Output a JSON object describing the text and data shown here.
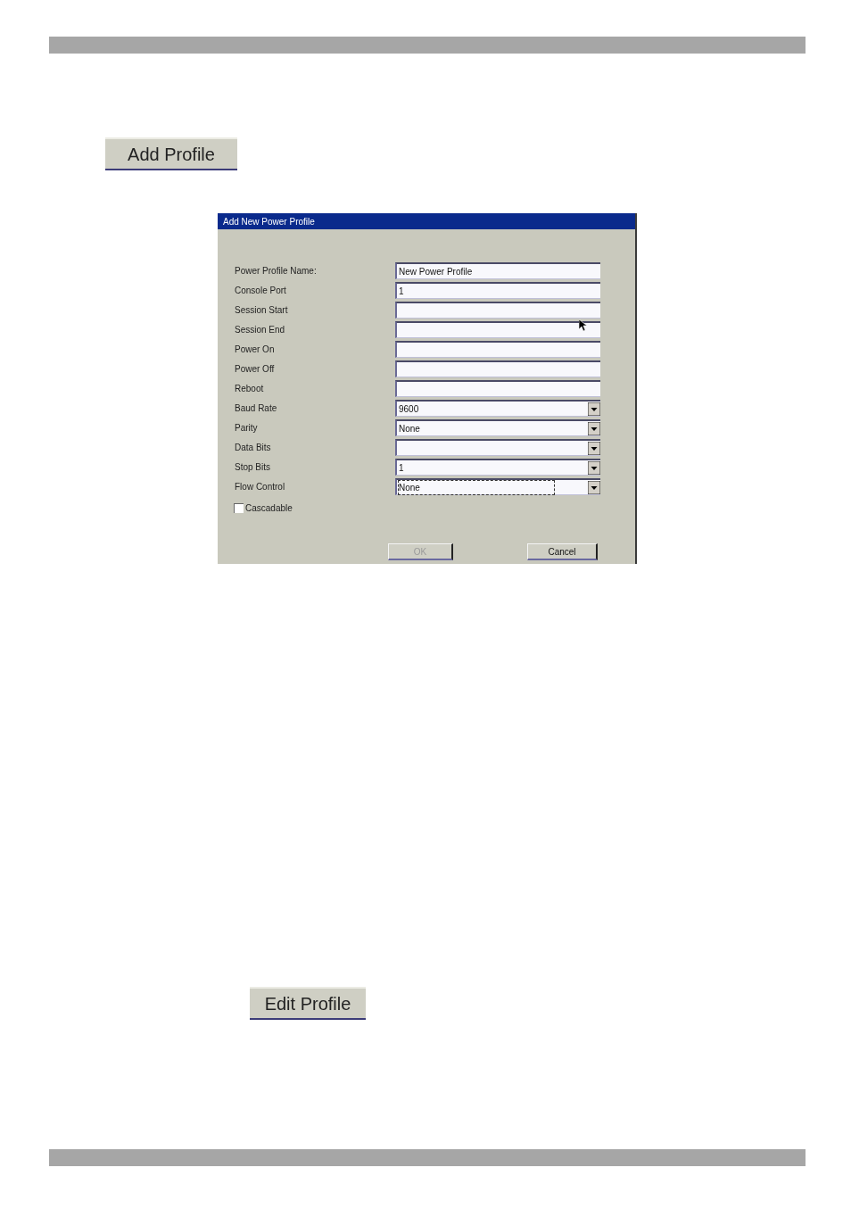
{
  "add_button": {
    "label": "Add Profile"
  },
  "dialog": {
    "title": "Add New Power Profile",
    "fields": [
      {
        "label": "Power Profile Name:",
        "kind": "text",
        "value": "New Power Profile"
      },
      {
        "label": "Console Port",
        "kind": "text",
        "value": "1"
      },
      {
        "label": "Session Start",
        "kind": "text"
      },
      {
        "label": "Session End",
        "kind": "text",
        "pointer": true
      },
      {
        "label": "Power On",
        "kind": "text"
      },
      {
        "label": "Power Off",
        "kind": "text"
      },
      {
        "label": "Reboot",
        "kind": "text"
      },
      {
        "label": "Baud Rate",
        "kind": "select",
        "value": "9600"
      },
      {
        "label": "Parity",
        "kind": "select",
        "value": "None"
      },
      {
        "label": "Data Bits",
        "kind": "select"
      },
      {
        "label": "Stop Bits",
        "kind": "select",
        "value": "1"
      },
      {
        "label": "Flow Control",
        "kind": "select",
        "value": "None",
        "focused": true
      }
    ],
    "checkbox": {
      "label": "Cascadable",
      "checked": false
    },
    "buttons": [
      {
        "label": "OK",
        "disabled": true
      },
      {
        "label": "Cancel",
        "disabled": false
      }
    ]
  },
  "edit_button": {
    "label": "Edit Profile"
  }
}
